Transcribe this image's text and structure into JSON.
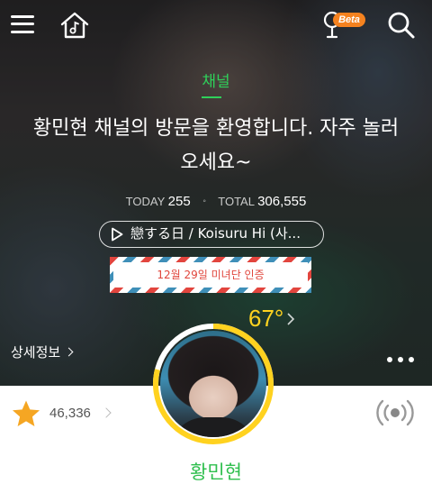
{
  "header": {
    "beta_label": "Beta",
    "icons": [
      "menu-icon",
      "music-home-icon",
      "microphone-icon",
      "search-icon"
    ]
  },
  "channel": {
    "section_label": "채널",
    "welcome_message": "황민현 채널의 방문을 환영합니다. 자주 놀러 오세요~",
    "today_label": "TODAY",
    "today_count": "255",
    "total_label": "TOTAL",
    "total_count": "306,555",
    "now_playing": "戀する日 / Koisuru Hi (사...",
    "badge_text": "12월 29일 미녀단 인증",
    "temperature": "67°",
    "detail_link": "상세정보",
    "favorite_count": "46,336",
    "artist_name": "황민현"
  },
  "colors": {
    "accent_green": "#2fd05a",
    "temperature_yellow": "#ffd21f",
    "beta_orange": "#f5821f",
    "star_orange": "#f5a623"
  }
}
